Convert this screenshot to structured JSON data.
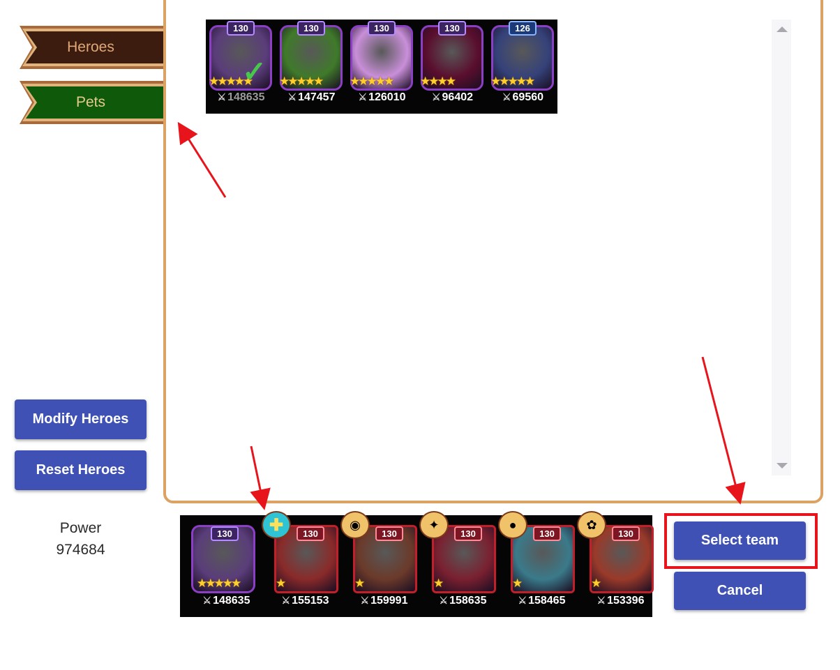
{
  "tabs": [
    {
      "label": "Heroes",
      "selected": false,
      "color": "#3b1c0e"
    },
    {
      "label": "Pets",
      "selected": true,
      "color": "#0f5a0a"
    }
  ],
  "pet_list": [
    {
      "level": "130",
      "stars": "★★★★★",
      "power": "148635",
      "selected": true,
      "bg": "#5a3d7a",
      "icon": "white-dragon-pet"
    },
    {
      "level": "130",
      "stars": "★★★★★",
      "power": "147457",
      "selected": false,
      "bg": "#3f7a2a",
      "icon": "green-creature-pet"
    },
    {
      "level": "130",
      "stars": "★★★★★",
      "power": "126010",
      "selected": false,
      "bg": "#c98fd9",
      "icon": "pink-axolotl-pet"
    },
    {
      "level": "130",
      "stars": "★★★★",
      "power": "96402",
      "selected": false,
      "bg": "#5a0e2e",
      "icon": "shadow-pet"
    },
    {
      "level": "126",
      "stars": "★★★★★",
      "power": "69560",
      "selected": false,
      "bg": "#35427a",
      "icon": "wolf-pet"
    }
  ],
  "team": [
    {
      "level": "130",
      "stars": "★★★★★",
      "power": "148635",
      "pet": true,
      "bg": "#5a3d7a",
      "badge": ""
    },
    {
      "level": "130",
      "stars": "★",
      "power": "155153",
      "pet": false,
      "bg": "#8a2a2a",
      "badge": "✚",
      "badge_style": "cross"
    },
    {
      "level": "130",
      "stars": "★",
      "power": "159991",
      "pet": false,
      "bg": "#6b3a2a",
      "badge": "◉",
      "badge_style": ""
    },
    {
      "level": "130",
      "stars": "★",
      "power": "158635",
      "pet": false,
      "bg": "#7a2030",
      "badge": "✦",
      "badge_style": ""
    },
    {
      "level": "130",
      "stars": "★",
      "power": "158465",
      "pet": false,
      "bg": "#3a7a8a",
      "badge": "●",
      "badge_style": ""
    },
    {
      "level": "130",
      "stars": "★",
      "power": "153396",
      "pet": false,
      "bg": "#9a3a2a",
      "badge": "✿",
      "badge_style": ""
    }
  ],
  "buttons": {
    "modify": "Modify Heroes",
    "reset": "Reset Heroes",
    "select": "Select team",
    "cancel": "Cancel"
  },
  "power": {
    "label": "Power",
    "value": "974684"
  },
  "colors": {
    "accent": "#3f51b5",
    "panel_border": "#dca264",
    "highlight": "#e8141b"
  }
}
